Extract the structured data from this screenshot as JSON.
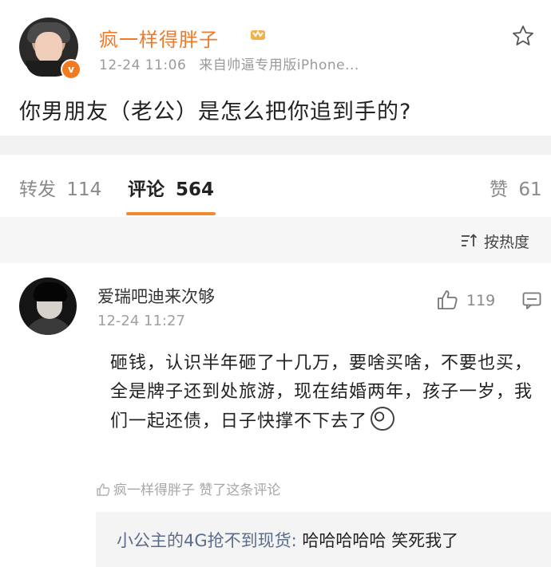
{
  "post": {
    "username": "疯一样得胖子",
    "time": "12-24 11:06",
    "source": "来自帅逼专用版iPhone...",
    "text": "你男朋友（老公）是怎么把你追到手的?",
    "verified_badge": "v",
    "icons": {
      "member": "member-crown-icon",
      "star": "star-icon",
      "verified": "verified-badge-icon"
    }
  },
  "tabs": {
    "repost_label": "转发",
    "repost_count": "114",
    "comment_label": "评论",
    "comment_count": "564",
    "like_label": "赞",
    "like_count": "61"
  },
  "sort": {
    "label": "按热度"
  },
  "comment": {
    "username": "爱瑞吧迪来次够",
    "time": "12-24 11:27",
    "like_count": "119",
    "body": "砸钱，认识半年砸了十几万，要啥买啥，不要也买，全是牌子还到处旅游，现在结婚两年，孩子一岁，我们一起还债，日子快撑不下去了",
    "liked_by": "疯一样得胖子 赞了这条评论"
  },
  "reply": {
    "user": "小公主的4G抢不到现货:",
    "text": " 哈哈哈哈哈 笑死我了"
  },
  "colors": {
    "accent_orange": "#f07a28",
    "tab_underline": "#f28a2c",
    "reply_user": "#5b6c8a",
    "meta_gray": "#9b9b9b"
  }
}
